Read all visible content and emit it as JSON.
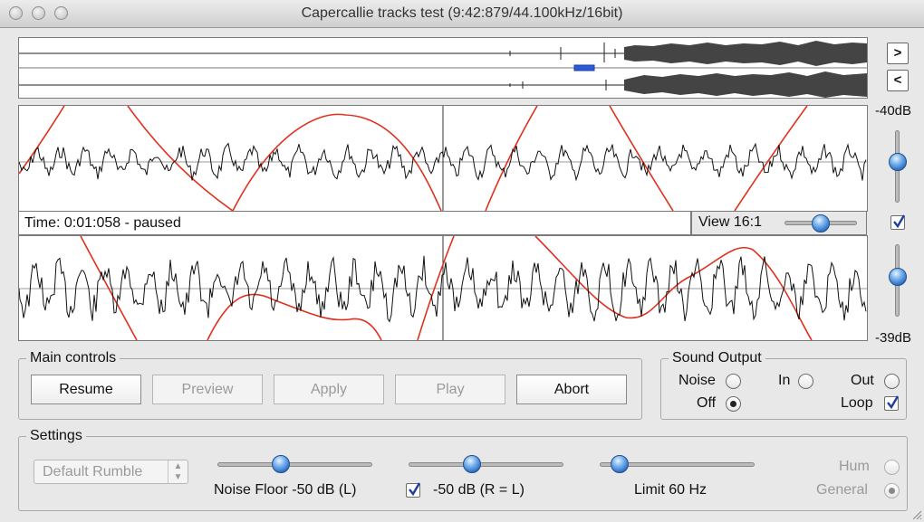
{
  "window": {
    "title": "Capercallie tracks test (9:42:879/44.100kHz/16bit)"
  },
  "overview": {
    "next_label": ">",
    "prev_label": "<"
  },
  "waveform": {
    "top_db_label": "-40dB",
    "bottom_db_label": "-39dB",
    "link_checked": true
  },
  "status": {
    "time_text": "Time: 0:01:058 - paused",
    "view_label": "View 16:1"
  },
  "main_controls": {
    "legend": "Main controls",
    "buttons": [
      {
        "label": "Resume",
        "enabled": true
      },
      {
        "label": "Preview",
        "enabled": false
      },
      {
        "label": "Apply",
        "enabled": false
      },
      {
        "label": "Play",
        "enabled": false
      },
      {
        "label": "Abort",
        "enabled": true
      }
    ]
  },
  "sound_output": {
    "legend": "Sound Output",
    "noise_label": "Noise",
    "off_label": "Off",
    "in_label": "In",
    "out_label": "Out",
    "loop_label": "Loop",
    "selected": "Off",
    "loop_checked": true
  },
  "settings": {
    "legend": "Settings",
    "preset_value": "Default Rumble",
    "noise_floor_label": "Noise Floor -50 dB (L)",
    "right_channel_label": "-50 dB (R = L)",
    "right_channel_checked": true,
    "limit_label": "Limit 60 Hz",
    "hum_label": "Hum",
    "general_label": "General",
    "mode_selected": "General"
  },
  "colors": {
    "waveform": "#111111",
    "curve": "#e0301e",
    "knob": "#2d6fc4",
    "overview_selection": "#2a5bd8"
  }
}
